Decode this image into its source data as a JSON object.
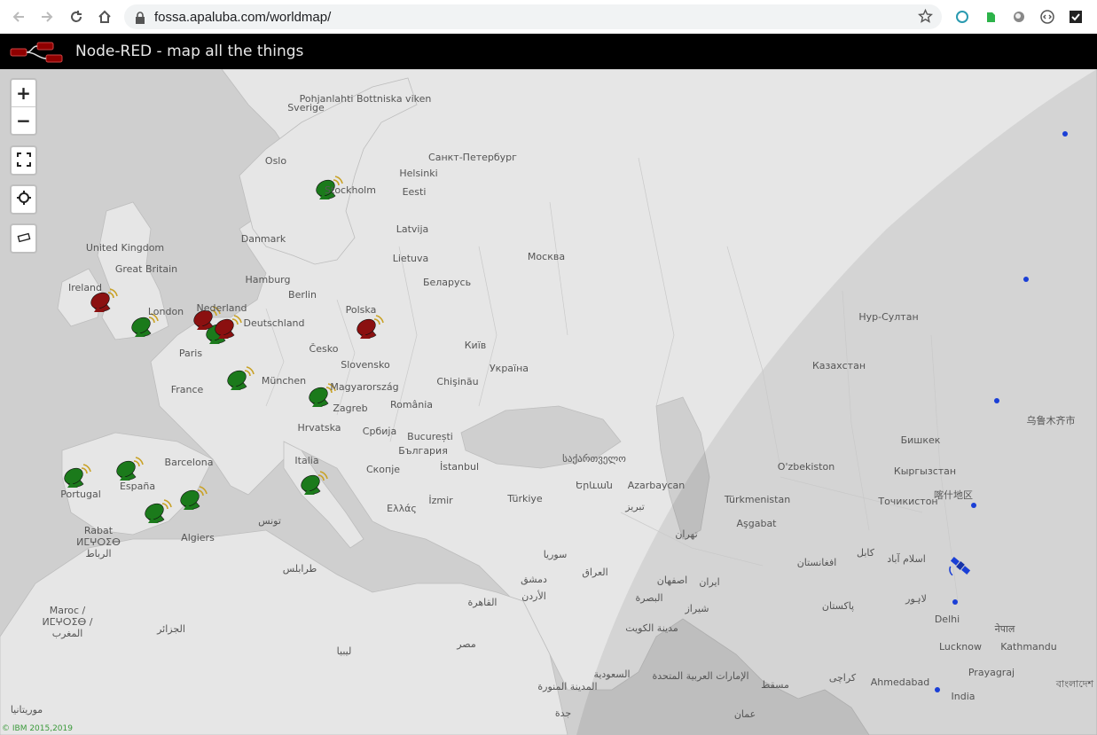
{
  "browser": {
    "url": "fossa.apaluba.com/worldmap/"
  },
  "app": {
    "title": "Node-RED - map all the things"
  },
  "map": {
    "controls": {
      "zoom_in": "+",
      "zoom_out": "−"
    },
    "labels": [
      "Sverige",
      "Pohjanlahti Bottniska viken",
      "Oslo",
      "Stockholm",
      "Helsinki",
      "Санкт-Петербург",
      "Eesti",
      "United Kingdom",
      "Great Britain",
      "Ireland",
      "Danmark",
      "Latvija",
      "Hamburg",
      "Lietuva",
      "Москва",
      "Berlin",
      "Беларусь",
      "London",
      "Nederland",
      "Polska",
      "Deutschland",
      "Česko",
      "Київ",
      "Paris",
      "Slovensko",
      "Україна",
      "München",
      "France",
      "Chişinău",
      "Magyarország",
      "Zagreb",
      "România",
      "Hrvatska",
      "Србија",
      "București",
      "България",
      "Barcelona",
      "Italia",
      "İstanbul",
      "Portugal",
      "España",
      "Скопје",
      "Ελλάς",
      "İzmir",
      "Türkiye",
      "Rabat",
      "ⵍⵎⵖⵔⵉⴱ",
      "الرباط",
      "Algiers",
      "تونس",
      "Maroc /",
      "ⵍⵎⵖⵔⵉⴱ /",
      "المغرب",
      "الجزائر",
      "طرابلس",
      "ليبيا",
      "مصر",
      "القاهرة",
      "سوريا",
      "دمشق",
      "العراق",
      "الأردن",
      "საქართველო",
      "Երևան",
      "Azarbaycan",
      "تبریز",
      "Türkmenistan",
      "Aşgabat",
      "O'zbekiston",
      "Нур-Султан",
      "Казахстан",
      "Бишкек",
      "Кыргызстан",
      "乌鲁木齐市",
      "喀什地区",
      "Точикистон",
      "تهران",
      "اصفهان",
      "ایران",
      "البصرة",
      "مدينة الكويت",
      "شیراز",
      "السعودية",
      "الإمارات العربية المتحدة",
      "مسقط",
      "عمان",
      "المدينة المنورة",
      "جدة",
      "کابل",
      "افغانستان",
      "اسلام آباد",
      "لاہور",
      "پاکستان",
      "Delhi",
      "Lucknow",
      "Kathmandu",
      "नेपाल",
      "Prayagraj",
      "Ahmedabad",
      "India",
      "کراچی",
      "موريتانيا",
      "বাংলাদেশ"
    ],
    "markers": {
      "green": [
        "station-stockholm",
        "station-london",
        "station-netherlands",
        "station-belgium",
        "station-zagreb",
        "station-italy",
        "station-portugal",
        "station-spain",
        "station-spain-south",
        "station-spain-east"
      ],
      "red": [
        "station-ireland",
        "station-netherlands-red",
        "station-germany-red",
        "station-poland"
      ],
      "satellite_points": 8
    },
    "colors": {
      "land": "#e4e4e4",
      "water": "#cfcfcf",
      "night": "rgba(0,0,0,0.12)",
      "marker_green": "#1b7a1b",
      "marker_red": "#8b1010",
      "satellite": "#1a3fd6",
      "header": "#000000"
    },
    "attribution": "© IBM 2015,2019"
  }
}
